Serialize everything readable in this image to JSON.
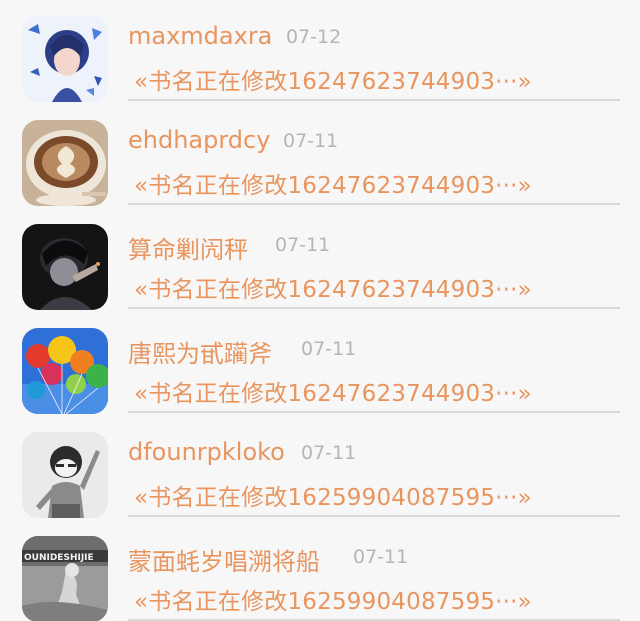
{
  "items": [
    {
      "name": "maxmdaxra",
      "date": "07-12",
      "book": "«书名正在修改16247623744903···»",
      "avatar": "butterfly-anime-avatar"
    },
    {
      "name": "ehdhaprdcy",
      "date": "07-11",
      "book": "«书名正在修改16247623744903···»",
      "avatar": "latte-art-avatar"
    },
    {
      "name": "算命剿闶秤",
      "date": "07-11",
      "book": "«书名正在修改16247623744903···»",
      "avatar": "dark-portrait-avatar"
    },
    {
      "name": "唐熙为甙躏斧",
      "date": "07-11",
      "book": "«书名正在修改16247623744903···»",
      "avatar": "balloons-avatar"
    },
    {
      "name": "dfounrpkloko",
      "date": "07-11",
      "book": "«书名正在修改16259904087595···»",
      "avatar": "cartoon-boy-avatar"
    },
    {
      "name": "蒙面蚝岁唱溯将船",
      "date": "07-11",
      "book": "«书名正在修改16259904087595···»",
      "avatar": "grayscale-photo-avatar",
      "avatar_text": "OUNIDESHIJIE"
    }
  ]
}
